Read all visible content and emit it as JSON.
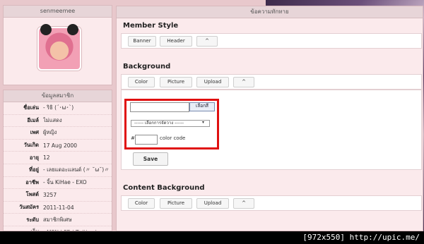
{
  "profile": {
    "username": "senmeemee"
  },
  "member_info": {
    "header": "ข้อมูลสมาชิก",
    "rows": [
      {
        "label": "ชื่อเล่น",
        "value": "- ริธิ (´･ω･`)"
      },
      {
        "label": "อีเมล์",
        "value": "ไม่แสดง"
      },
      {
        "label": "เพศ",
        "value": "ผู้หญิง"
      },
      {
        "label": "วันเกิด",
        "value": "17 Aug 2000"
      },
      {
        "label": "อายุ",
        "value": "12"
      },
      {
        "label": "ที่อยู่",
        "value": "- เลยแดอะแลนด์ (〃 ˘ω˘)〃"
      },
      {
        "label": "อาชีพ",
        "value": "- จิ้น KiHae - EXO"
      },
      {
        "label": "โพสต์",
        "value": "3257"
      },
      {
        "label": "วันสมัคร",
        "value": "2011-11-04"
      },
      {
        "label": "ระดับ",
        "value": "สมาชิกพิเศษ"
      },
      {
        "label": "เว็บ",
        "value": "- MSN | FB | Twitter |"
      }
    ]
  },
  "main": {
    "header": "ข้อความทักทาย",
    "member_style": {
      "title": "Member Style",
      "buttons": [
        "Banner",
        "Header",
        "^"
      ]
    },
    "background": {
      "title": "Background",
      "buttons": [
        "Color",
        "Picture",
        "Upload",
        "^"
      ],
      "color_input_value": "",
      "picker_label": "เลือกสี",
      "select_value": "------ เลือกการจัดวาง ------",
      "hash_label": "#",
      "code_value": "",
      "color_code_label": "color code",
      "save_label": "Save"
    },
    "content_background": {
      "title": "Content Background",
      "buttons": [
        "Color",
        "Picture",
        "Upload",
        "^"
      ]
    }
  },
  "footer": {
    "watermark": "[972x550] http://upic.me/"
  }
}
